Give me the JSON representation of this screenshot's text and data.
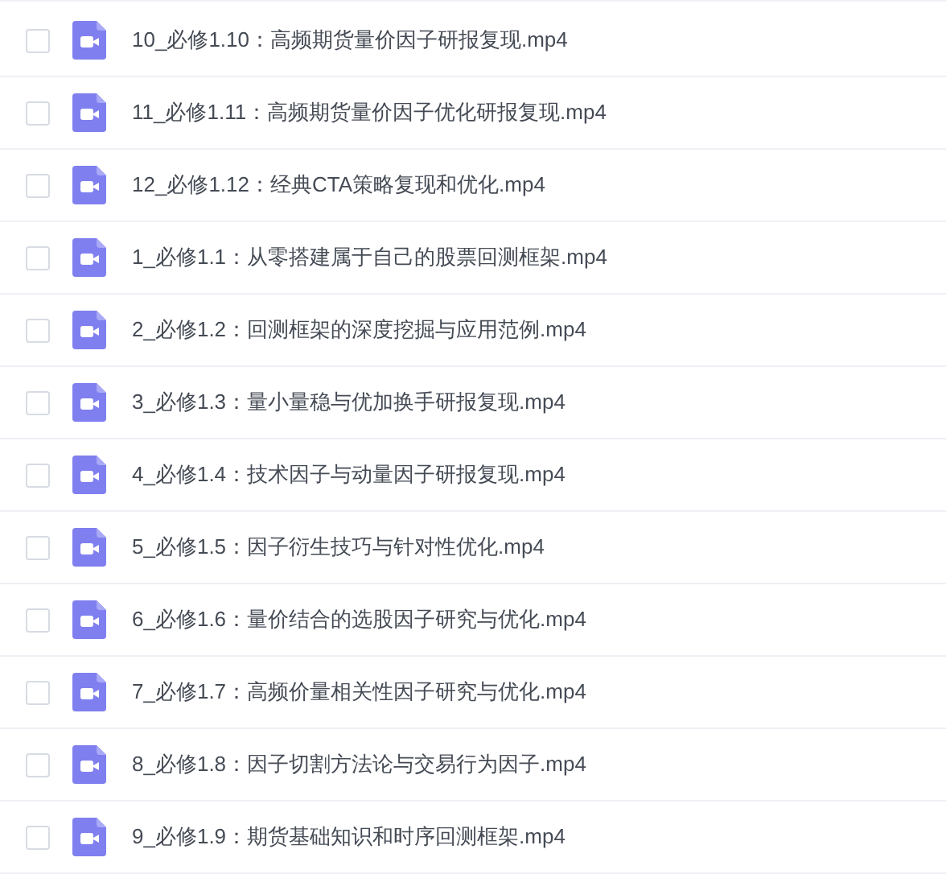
{
  "files": [
    {
      "name": "10_必修1.10：高频期货量价因子研报复现.mp4",
      "checked": false
    },
    {
      "name": "11_必修1.11：高频期货量价因子优化研报复现.mp4",
      "checked": false
    },
    {
      "name": "12_必修1.12：经典CTA策略复现和优化.mp4",
      "checked": false
    },
    {
      "name": "1_必修1.1：从零搭建属于自己的股票回测框架.mp4",
      "checked": false
    },
    {
      "name": "2_必修1.2：回测框架的深度挖掘与应用范例.mp4",
      "checked": false
    },
    {
      "name": "3_必修1.3：量小量稳与优加换手研报复现.mp4",
      "checked": false
    },
    {
      "name": "4_必修1.4：技术因子与动量因子研报复现.mp4",
      "checked": false
    },
    {
      "name": "5_必修1.5：因子衍生技巧与针对性优化.mp4",
      "checked": false
    },
    {
      "name": "6_必修1.6：量价结合的选股因子研究与优化.mp4",
      "checked": false
    },
    {
      "name": "7_必修1.7：高频价量相关性因子研究与优化.mp4",
      "checked": false
    },
    {
      "name": "8_必修1.8：因子切割方法论与交易行为因子.mp4",
      "checked": false
    },
    {
      "name": "9_必修1.9：期货基础知识和时序回测框架.mp4",
      "checked": false
    }
  ]
}
